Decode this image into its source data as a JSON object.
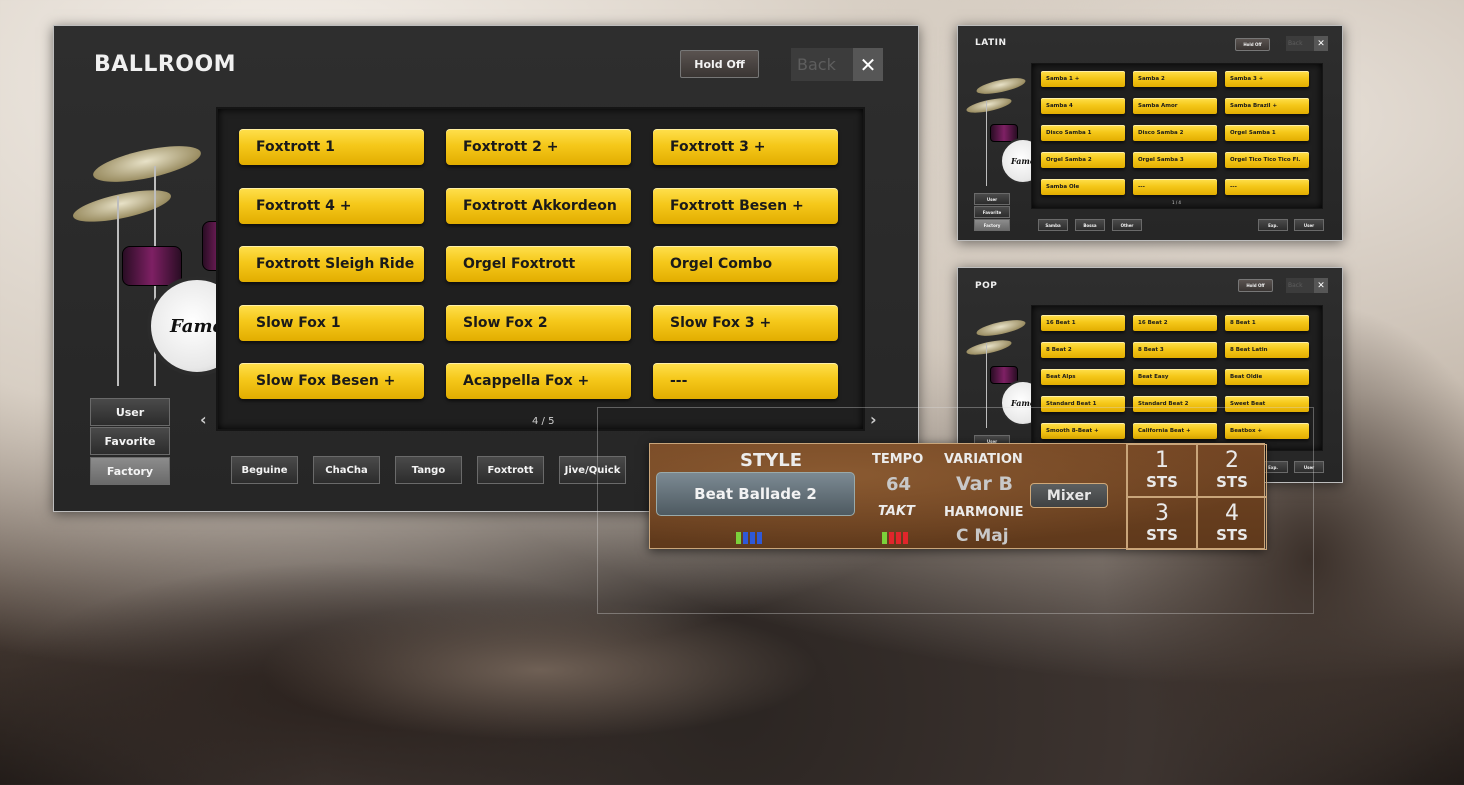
{
  "ballroom": {
    "title": "BALLROOM",
    "hold": "Hold Off",
    "back": "Back",
    "close": "✕",
    "buttons": [
      "Foxtrott 1",
      "Foxtrott 2 +",
      "Foxtrott 3 +",
      "Foxtrott 4 +",
      "Foxtrott Akkordeon",
      "Foxtrott Besen +",
      "Foxtrott Sleigh Ride",
      "Orgel Foxtrott",
      "Orgel Combo",
      "Slow Fox 1",
      "Slow Fox 2",
      "Slow Fox 3 +",
      "Slow Fox Besen +",
      "Acappella Fox +",
      "---"
    ],
    "page": "4 / 5",
    "side": [
      "User",
      "Favorite",
      "Factory"
    ],
    "categories": [
      "Beguine",
      "ChaCha",
      "Tango",
      "Foxtrott",
      "Jive/Quick"
    ],
    "arrow_left": "‹",
    "arrow_right": "›",
    "brand": "Fame"
  },
  "latin": {
    "title": "LATIN",
    "hold": "Hold Off",
    "back": "Back",
    "close": "✕",
    "buttons": [
      "Samba 1 +",
      "Samba 2",
      "Samba 3 +",
      "Samba 4",
      "Samba Amor",
      "Samba Brazil +",
      "Disco Samba 1",
      "Disco Samba 2",
      "Orgel Samba 1",
      "Orgel Samba 2",
      "Orgel Samba 3",
      "Orgel Tico Tico Tico Fl.",
      "Samba Ole",
      "---",
      "---"
    ],
    "page": "1 / 4",
    "side": [
      "User",
      "Favorite",
      "Factory"
    ],
    "categories": [
      "Samba",
      "Bossa",
      "Other"
    ],
    "right_buttons": [
      "Exp.",
      "User"
    ],
    "brand": "Fame"
  },
  "pop": {
    "title": "POP",
    "hold": "Hold Off",
    "back": "Back",
    "close": "✕",
    "buttons": [
      "16 Beat 1",
      "16 Beat 2",
      "8 Beat 1",
      "8 Beat 2",
      "8 Beat 3",
      "8 Beat Latin",
      "Beat Alps",
      "Beat Easy",
      "Beat Oldie",
      "Standard Beat 1",
      "Standard Beat 2",
      "Sweet Beat",
      "Smooth 8-Beat +",
      "California Beat +",
      "Beatbox +"
    ],
    "side": [
      "User"
    ],
    "right_buttons": [
      "Exp.",
      "User"
    ],
    "brand": "Fame"
  },
  "style_bar": {
    "style_label": "STYLE",
    "style_value": "Beat Ballade 2",
    "tempo_label": "TEMPO",
    "tempo_value": "64",
    "takt_label": "TAKT",
    "variation_label": "VARIATION",
    "variation_value": "Var B",
    "harmonie_label": "HARMONIE",
    "harmonie_value": "C Maj",
    "mixer": "Mixer",
    "sts": [
      {
        "num": "1",
        "label": "STS"
      },
      {
        "num": "2",
        "label": "STS"
      },
      {
        "num": "3",
        "label": "STS"
      },
      {
        "num": "4",
        "label": "STS"
      }
    ]
  },
  "colors": {
    "button_yellow": "#f5c81a",
    "panel_bg": "#2e2e2e",
    "style_bar_brown": "#6a4020"
  }
}
